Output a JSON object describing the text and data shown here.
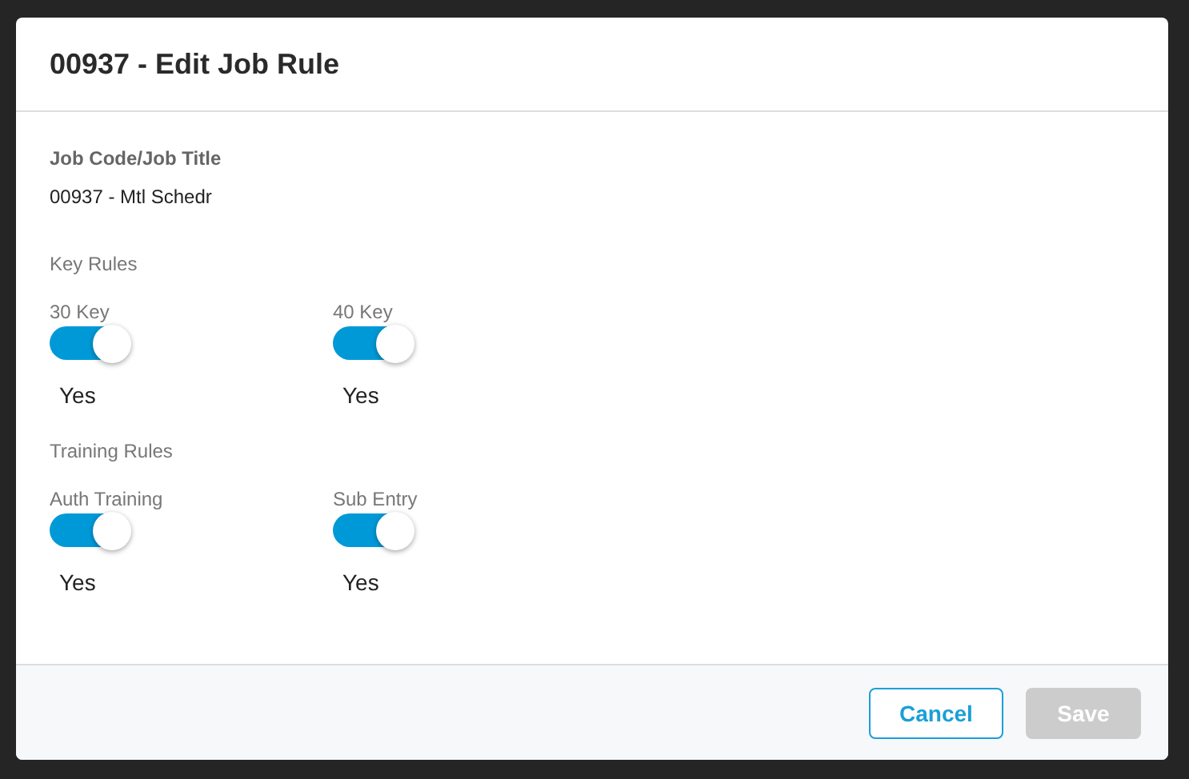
{
  "dialog": {
    "title": "00937 - Edit Job Rule",
    "job_field": {
      "label": "Job Code/Job Title",
      "value": "00937 - Mtl Schedr"
    },
    "sections": [
      {
        "title": "Key Rules",
        "toggles": [
          {
            "label": "30 Key",
            "on": true,
            "value": "Yes"
          },
          {
            "label": "40 Key",
            "on": true,
            "value": "Yes"
          }
        ]
      },
      {
        "title": "Training Rules",
        "toggles": [
          {
            "label": "Auth Training",
            "on": true,
            "value": "Yes"
          },
          {
            "label": "Sub Entry",
            "on": true,
            "value": "Yes"
          }
        ]
      }
    ],
    "buttons": [
      {
        "label": "Cancel",
        "kind": "secondary",
        "disabled": false
      },
      {
        "label": "Save",
        "kind": "primary",
        "disabled": true
      }
    ]
  }
}
